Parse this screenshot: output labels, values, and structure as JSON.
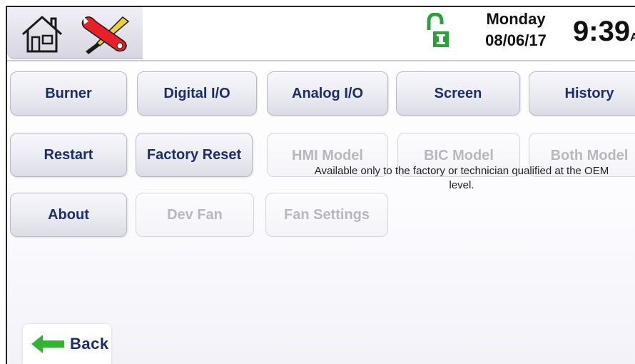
{
  "header": {
    "day": "Monday",
    "date": "08/06/17",
    "time": "9:39",
    "ampm": "A",
    "icons": [
      "home-icon",
      "tools-icon",
      "unlocked-padlock-icon"
    ],
    "colors": {
      "tools_red": "#e8202a",
      "tools_yellow": "#f2d02a",
      "lock_green": "#27a33a"
    }
  },
  "buttons": {
    "burner": "Burner",
    "digital_io": "Digital I/O",
    "analog_io": "Analog I/O",
    "screen": "Screen",
    "history": "History",
    "restart": "Restart",
    "factory_reset": "Factory Reset",
    "hmi_model": "HMI Model",
    "bic_model": "BIC Model",
    "both_model": "Both Model",
    "about": "About",
    "dev_fan": "Dev Fan",
    "fan_settings": "Fan Settings"
  },
  "notice": "Available only to the factory or technician qualified at the OEM level.",
  "back": {
    "label": "Back",
    "icon": "back-arrow-icon",
    "arrow_color": "#2fb52f"
  },
  "accent": {
    "button_text": "#1c2d6e",
    "disabled_text": "#b7b7bf"
  }
}
